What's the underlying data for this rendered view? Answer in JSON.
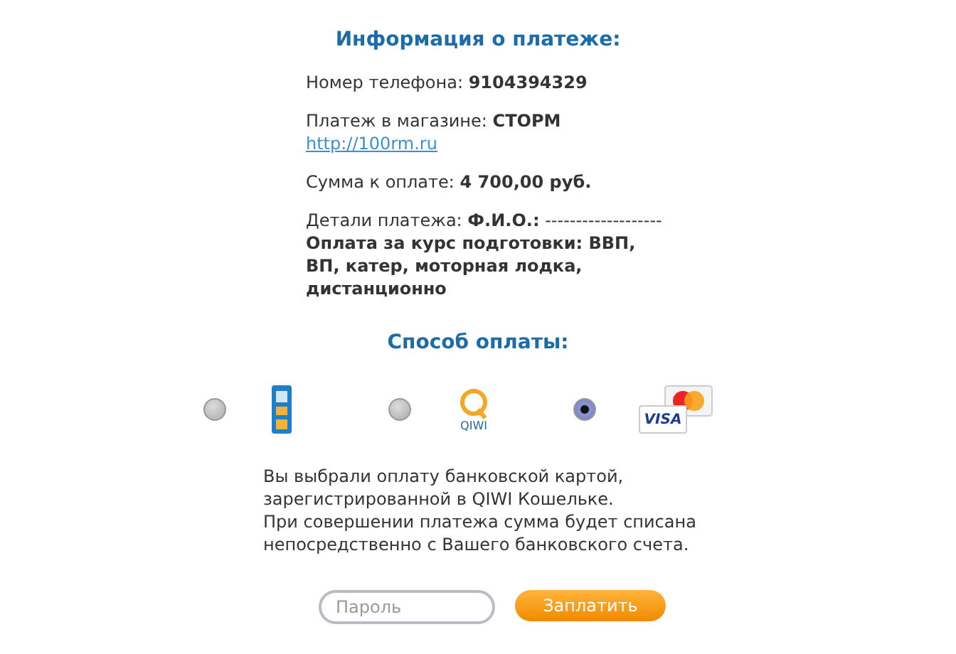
{
  "title": "Информация о платеже:",
  "info": [
    {
      "kind": "text",
      "text": "Номер телефона: **9104394329**"
    },
    {
      "kind": "link",
      "text": "Платеж в магазине: **СТОРМ**",
      "link": "http://100rm.ru"
    },
    {
      "kind": "text",
      "text": "Сумма к оплате: **4 700,00 руб.**"
    },
    {
      "kind": "text",
      "text": "Детали платежа: **Ф.И.О.:** ------------------- **Оплата за курс подготовки: ВВП, ВП, катер, моторная лодка, дистанционно**"
    }
  ],
  "methods_title": "Способ оплаты:",
  "methods": [
    {
      "kind": "terminal",
      "selected": false
    },
    {
      "kind": "qiwi",
      "selected": false,
      "logo_text": "QIWI"
    },
    {
      "kind": "card",
      "selected": true,
      "logo_text": "VISA"
    }
  ],
  "description": [
    "Вы выбрали оплату банковской картой, зарегистрированной в QIWI Кошельке.",
    "При совершении платежа сумма будет списана непосредственно с Вашего банковского счета."
  ],
  "password": {
    "placeholder": "Пароль"
  },
  "pay_button": "Заплатить"
}
